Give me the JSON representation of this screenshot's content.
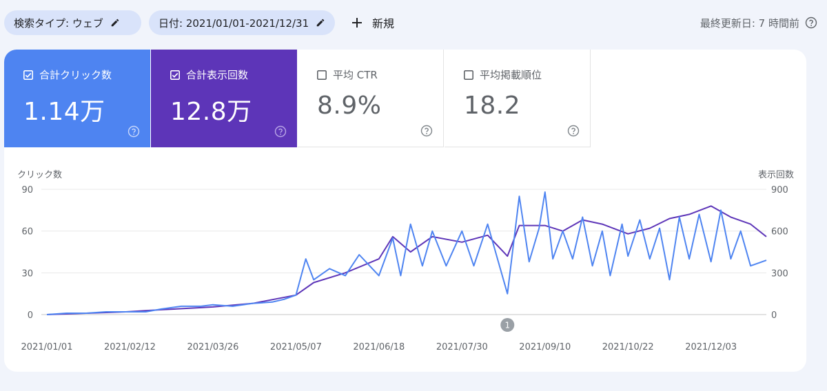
{
  "topbar": {
    "search_type": "検索タイプ: ウェブ",
    "date": "日付: 2021/01/01-2021/12/31",
    "new_label": "新規",
    "last_updated": "最終更新日: 7 時間前"
  },
  "metrics": [
    {
      "label": "合計クリック数",
      "value": "1.14万",
      "checked": true,
      "color": "#4e84f1"
    },
    {
      "label": "合計表示回数",
      "value": "12.8万",
      "checked": true,
      "color": "#5d35b8"
    },
    {
      "label": "平均 CTR",
      "value": "8.9%",
      "checked": false
    },
    {
      "label": "平均掲載順位",
      "value": "18.2",
      "checked": false
    }
  ],
  "chart_data": {
    "type": "line",
    "left_axis_label": "クリック数",
    "right_axis_label": "表示回数",
    "ylim_left": [
      0,
      90
    ],
    "ylim_right": [
      0,
      900
    ],
    "yticks_left": [
      "0",
      "30",
      "60",
      "90"
    ],
    "yticks_right": [
      "0",
      "300",
      "600",
      "900"
    ],
    "xlim": [
      "2021/01/01",
      "2021/12/31"
    ],
    "xticks": [
      "2021/01/01",
      "2021/02/12",
      "2021/03/26",
      "2021/05/07",
      "2021/06/18",
      "2021/07/30",
      "2021/09/10",
      "2021/10/22",
      "2021/12/03"
    ],
    "annotation": {
      "label": "1",
      "date": "2021/08/22"
    },
    "grid": true,
    "series": [
      {
        "name": "合計クリック数",
        "axis": "left",
        "color": "#4e84f1",
        "points": [
          [
            "2021/01/01",
            0
          ],
          [
            "2021/01/11",
            1
          ],
          [
            "2021/01/21",
            1
          ],
          [
            "2021/01/31",
            2
          ],
          [
            "2021/02/10",
            2
          ],
          [
            "2021/02/20",
            2
          ],
          [
            "2021/02/28",
            4
          ],
          [
            "2021/03/10",
            6
          ],
          [
            "2021/03/20",
            6
          ],
          [
            "2021/03/26",
            7
          ],
          [
            "2021/04/05",
            6
          ],
          [
            "2021/04/15",
            8
          ],
          [
            "2021/04/25",
            9
          ],
          [
            "2021/05/01",
            11
          ],
          [
            "2021/05/07",
            14
          ],
          [
            "2021/05/12",
            40
          ],
          [
            "2021/05/16",
            25
          ],
          [
            "2021/05/24",
            33
          ],
          [
            "2021/06/01",
            28
          ],
          [
            "2021/06/08",
            43
          ],
          [
            "2021/06/18",
            28
          ],
          [
            "2021/06/25",
            55
          ],
          [
            "2021/06/29",
            28
          ],
          [
            "2021/07/04",
            65
          ],
          [
            "2021/07/10",
            35
          ],
          [
            "2021/07/15",
            60
          ],
          [
            "2021/07/22",
            35
          ],
          [
            "2021/07/30",
            60
          ],
          [
            "2021/08/05",
            35
          ],
          [
            "2021/08/12",
            65
          ],
          [
            "2021/08/17",
            40
          ],
          [
            "2021/08/22",
            15
          ],
          [
            "2021/08/28",
            85
          ],
          [
            "2021/09/02",
            38
          ],
          [
            "2021/09/07",
            62
          ],
          [
            "2021/09/10",
            88
          ],
          [
            "2021/09/14",
            40
          ],
          [
            "2021/09/19",
            60
          ],
          [
            "2021/09/24",
            40
          ],
          [
            "2021/09/29",
            70
          ],
          [
            "2021/10/04",
            35
          ],
          [
            "2021/10/09",
            60
          ],
          [
            "2021/10/13",
            28
          ],
          [
            "2021/10/19",
            65
          ],
          [
            "2021/10/22",
            42
          ],
          [
            "2021/10/28",
            68
          ],
          [
            "2021/11/02",
            40
          ],
          [
            "2021/11/07",
            62
          ],
          [
            "2021/11/12",
            25
          ],
          [
            "2021/11/17",
            70
          ],
          [
            "2021/11/22",
            40
          ],
          [
            "2021/11/27",
            72
          ],
          [
            "2021/12/03",
            38
          ],
          [
            "2021/12/08",
            75
          ],
          [
            "2021/12/13",
            40
          ],
          [
            "2021/12/18",
            60
          ],
          [
            "2021/12/23",
            35
          ],
          [
            "2021/12/31",
            39
          ]
        ]
      },
      {
        "name": "合計表示回数",
        "axis": "right",
        "color": "#5d35b8",
        "points": [
          [
            "2021/01/01",
            0
          ],
          [
            "2021/01/21",
            10
          ],
          [
            "2021/02/10",
            20
          ],
          [
            "2021/02/28",
            35
          ],
          [
            "2021/03/20",
            50
          ],
          [
            "2021/03/26",
            55
          ],
          [
            "2021/04/15",
            80
          ],
          [
            "2021/05/07",
            140
          ],
          [
            "2021/05/16",
            230
          ],
          [
            "2021/06/01",
            300
          ],
          [
            "2021/06/18",
            400
          ],
          [
            "2021/06/25",
            560
          ],
          [
            "2021/07/04",
            450
          ],
          [
            "2021/07/15",
            560
          ],
          [
            "2021/07/30",
            520
          ],
          [
            "2021/08/12",
            570
          ],
          [
            "2021/08/22",
            420
          ],
          [
            "2021/08/28",
            640
          ],
          [
            "2021/09/10",
            640
          ],
          [
            "2021/09/19",
            600
          ],
          [
            "2021/09/29",
            680
          ],
          [
            "2021/10/09",
            650
          ],
          [
            "2021/10/22",
            580
          ],
          [
            "2021/11/02",
            620
          ],
          [
            "2021/11/12",
            690
          ],
          [
            "2021/11/22",
            720
          ],
          [
            "2021/12/03",
            780
          ],
          [
            "2021/12/13",
            700
          ],
          [
            "2021/12/23",
            650
          ],
          [
            "2021/12/31",
            560
          ]
        ]
      }
    ]
  }
}
